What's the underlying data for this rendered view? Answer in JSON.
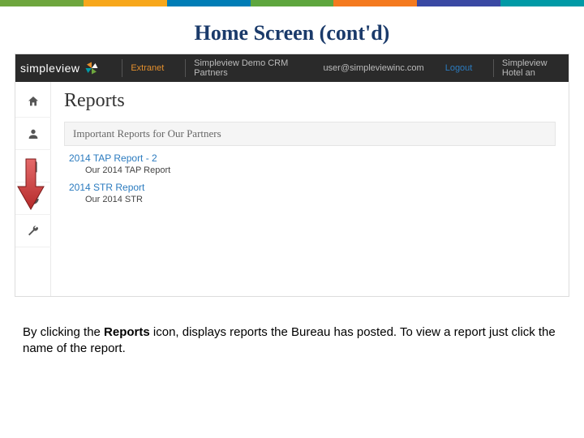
{
  "color_bar": [
    "#6ea63e",
    "#f7a71b",
    "#007db6",
    "#5ea63e",
    "#f47a1f",
    "#3a49a3",
    "#009aa6"
  ],
  "slide_title": "Home Screen (cont'd)",
  "appbar": {
    "brand": "simpleview",
    "extranet": "Extranet",
    "context": "Simpleview Demo CRM Partners",
    "user": "user@simpleviewinc.com",
    "logout": "Logout",
    "hotel": "Simpleview Hotel an"
  },
  "sidebar": {
    "items": [
      "home",
      "user",
      "reports-pointer",
      "chart",
      "wrench"
    ]
  },
  "page": {
    "heading": "Reports",
    "section": "Important Reports for Our Partners",
    "reports": [
      {
        "title": "2014 TAP Report - 2",
        "sub": "Our 2014 TAP Report"
      },
      {
        "title": "2014 STR Report",
        "sub": "Our 2014 STR"
      }
    ]
  },
  "caption": {
    "pre": "By clicking the ",
    "bold": "Reports",
    "post": " icon, displays reports the Bureau has posted.  To view a report just click the name of the report."
  }
}
